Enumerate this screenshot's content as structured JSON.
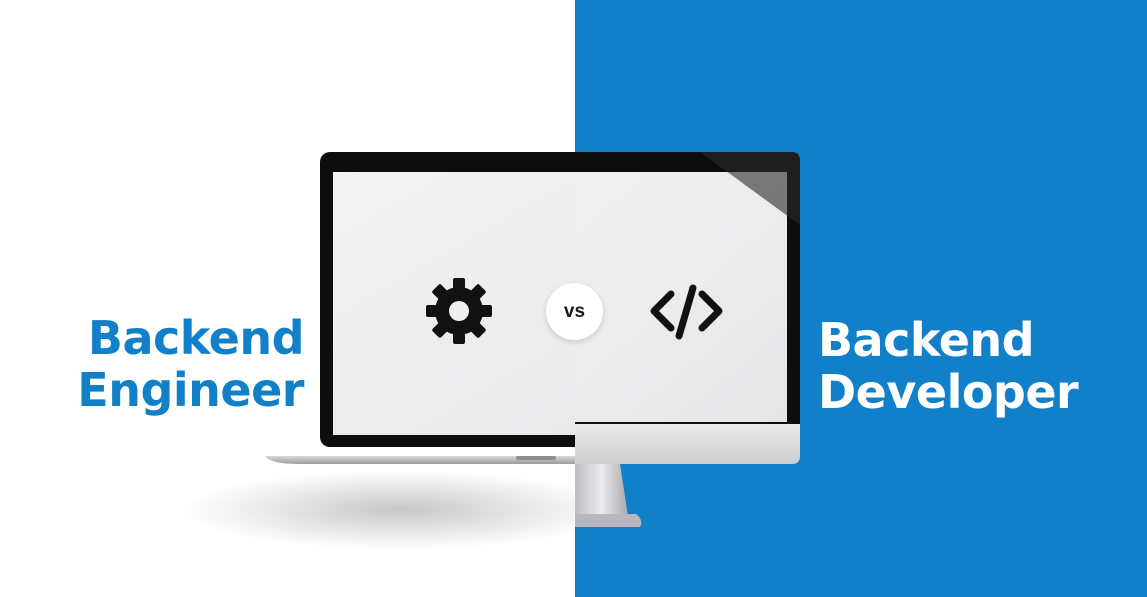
{
  "colors": {
    "left_background": "#ffffff",
    "right_background": "#1180c8",
    "left_title": "#1180c8",
    "right_title": "#ffffff",
    "icon": "#111111",
    "screen": "#efeff0",
    "bezel": "#0d0d0d"
  },
  "left": {
    "title_line1": "Backend",
    "title_line2": "Engineer",
    "device": "laptop",
    "icon": "gear-icon"
  },
  "right": {
    "title_line1": "Backend",
    "title_line2": "Developer",
    "device": "desktop-monitor",
    "icon": "code-icon"
  },
  "badge": {
    "label": "vs"
  }
}
